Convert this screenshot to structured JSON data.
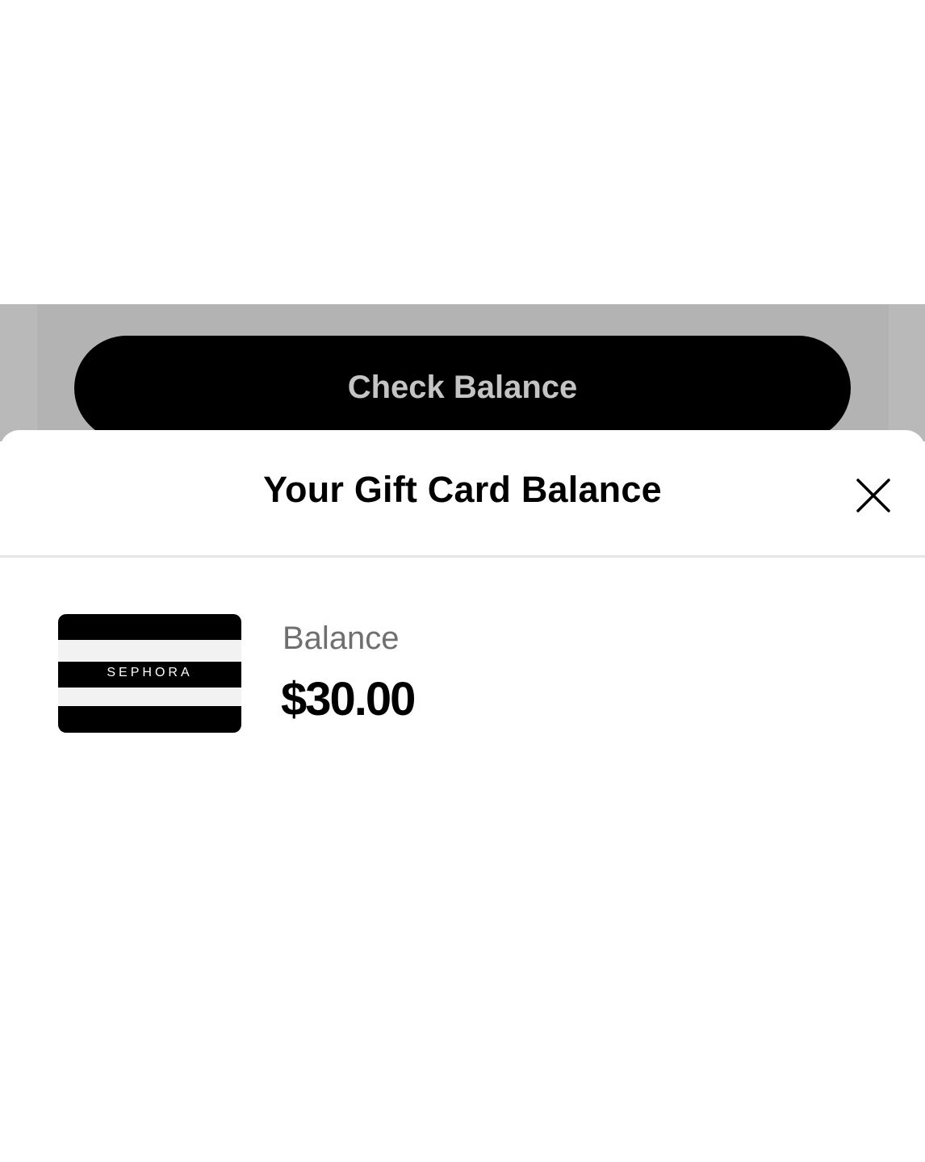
{
  "background_button": {
    "label": "Check Balance"
  },
  "sheet": {
    "title": "Your Gift Card Balance",
    "close_icon": "close-icon"
  },
  "gift_card": {
    "brand": "SEPHORA"
  },
  "balance": {
    "label": "Balance",
    "amount": "$30.00"
  },
  "colors": {
    "button_background": "#000000",
    "button_text": "#c4c4c4",
    "overlay": "#b9b9ba",
    "label_gray": "#6f6f6f",
    "divider": "#e6e6e6"
  }
}
